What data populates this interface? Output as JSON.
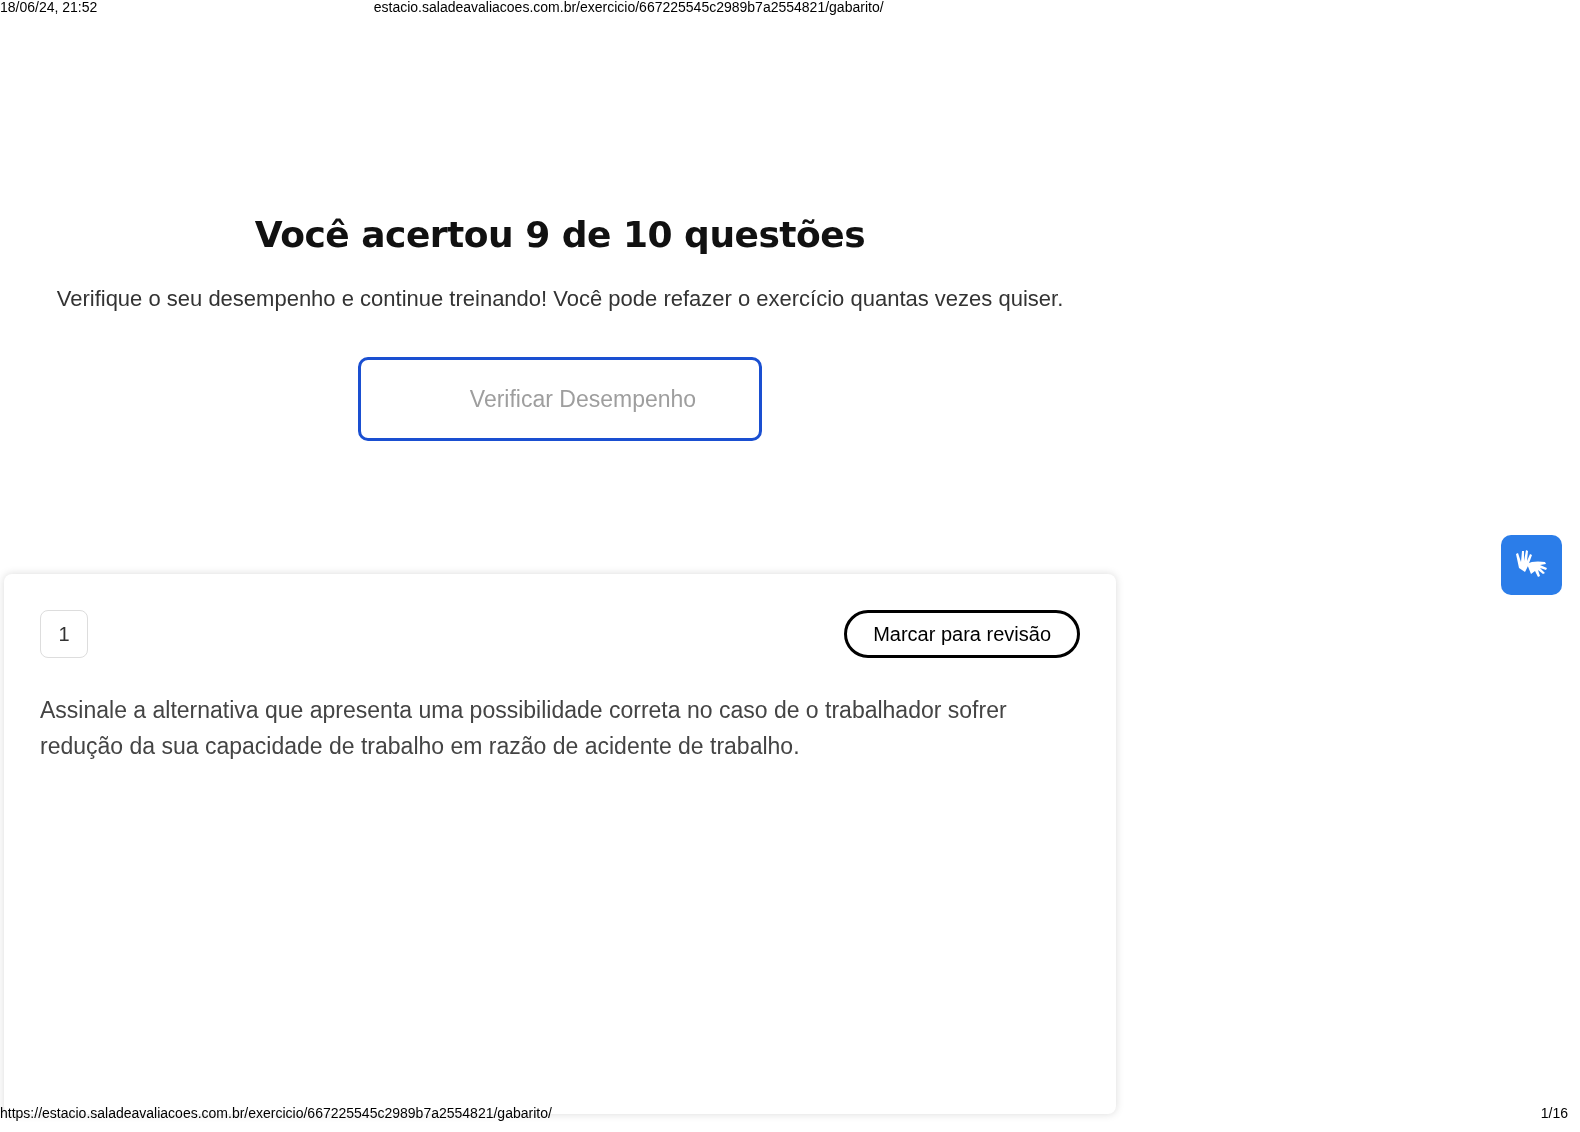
{
  "print_header": {
    "date": "18/06/24, 21:52",
    "url": "estacio.saladeavaliacoes.com.br/exercicio/667225545c2989b7a2554821/gabarito/"
  },
  "result": {
    "title": "Você acertou 9 de 10 questões",
    "subtitle": "Verifique o seu desempenho e continue treinando! Você pode refazer o exercício quantas vezes quiser.",
    "button": "Verificar Desempenho"
  },
  "question": {
    "number": "1",
    "review_button": "Marcar para revisão",
    "text": "Assinale a alternativa que apresenta uma possibilidade correta no caso de o trabalhador sofrer redução da sua capacidade de trabalho em razão de acidente de trabalho."
  },
  "print_footer": {
    "url": "https://estacio.saladeavaliacoes.com.br/exercicio/667225545c2989b7a2554821/gabarito/",
    "page": "1/16"
  }
}
